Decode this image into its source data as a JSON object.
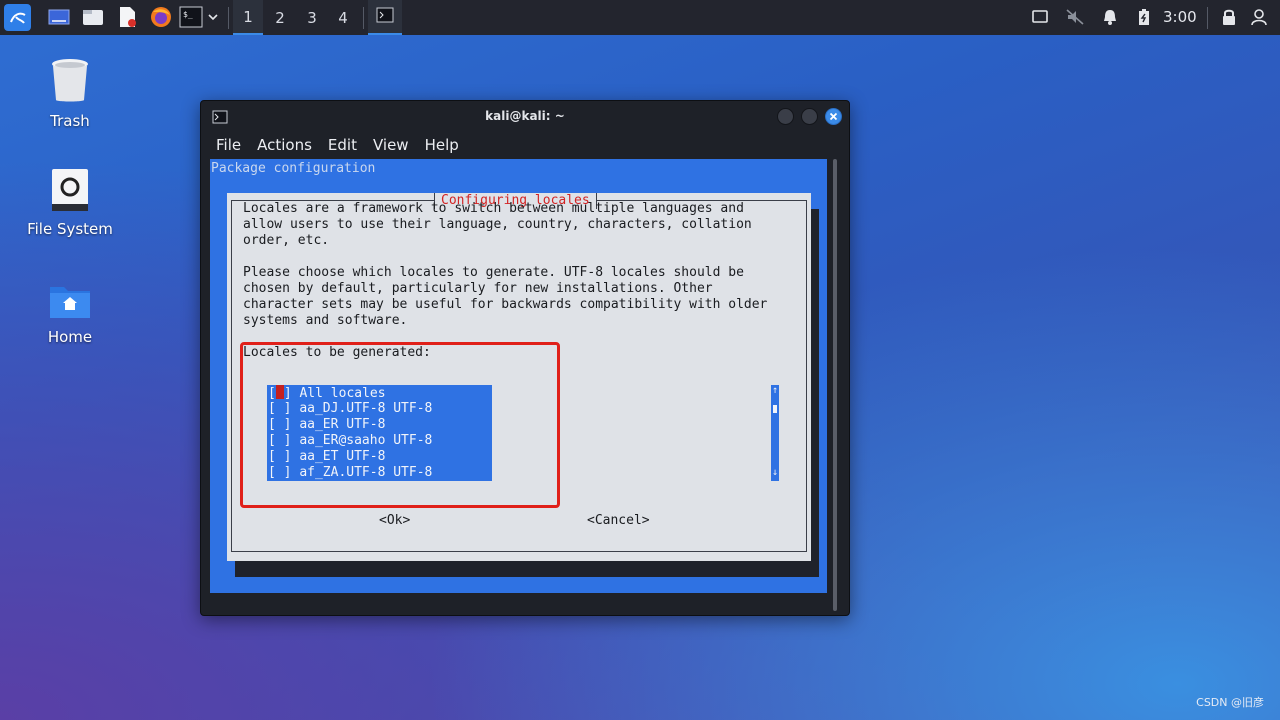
{
  "taskbar": {
    "workspaces": [
      "1",
      "2",
      "3",
      "4"
    ],
    "clock": "3:00",
    "icons": [
      "kali-menu-icon",
      "show-desktop-icon",
      "file-manager-icon",
      "text-editor-icon",
      "firefox-icon",
      "terminal-icon",
      "chevron-down-icon",
      "terminal-task-icon",
      "display-icon",
      "mute-icon",
      "bell-icon",
      "battery-icon",
      "lock-icon"
    ]
  },
  "desktop": {
    "items": [
      {
        "label": "Trash",
        "icon": "trash-icon"
      },
      {
        "label": "File System",
        "icon": "drive-icon"
      },
      {
        "label": "Home",
        "icon": "home-folder-icon"
      }
    ]
  },
  "window": {
    "title": "kali@kali: ~",
    "menu": [
      "File",
      "Actions",
      "Edit",
      "View",
      "Help"
    ]
  },
  "terminal": {
    "header": "Package configuration",
    "dialog_title": "Configuring locales",
    "paragraph1": [
      "Locales are a framework to switch between multiple languages and",
      "allow users to use their language, country, characters, collation",
      "order, etc."
    ],
    "paragraph2": [
      "Please choose which locales to generate. UTF-8 locales should be",
      "chosen by default, particularly for new installations. Other",
      "character sets may be useful for backwards compatibility with older",
      "systems and software."
    ],
    "list_label": "Locales to be generated:",
    "items": [
      "All locales",
      "aa_DJ.UTF-8 UTF-8",
      "aa_ER UTF-8",
      "aa_ER@saaho UTF-8",
      "aa_ET UTF-8",
      "af_ZA.UTF-8 UTF-8"
    ],
    "checkbox_open": "[",
    "checkbox_empty": "[ ]",
    "checkbox_close": "]",
    "ok_label": "<Ok>",
    "cancel_label": "<Cancel>",
    "scroll_up": "↑",
    "scroll_down": "↓"
  },
  "colors": {
    "accent": "#2f72e3",
    "highlight_box": "#e0201a",
    "dialog_title": "#d22424"
  },
  "watermark": "CSDN @旧彦"
}
